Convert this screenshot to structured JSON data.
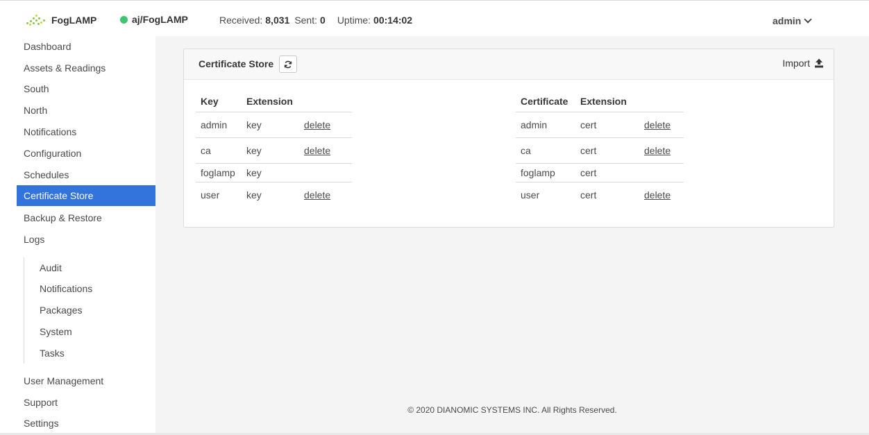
{
  "navbar": {
    "brand": "FogLAMP",
    "instance": "aj/FogLAMP",
    "received_label": "Received:",
    "received_value": "8,031",
    "sent_label": "Sent:",
    "sent_value": "0",
    "uptime_label": "Uptime:",
    "uptime_value": "00:14:02",
    "user": "admin",
    "status_color": "#3ec46d"
  },
  "sidebar": {
    "items": [
      {
        "label": "Dashboard"
      },
      {
        "label": "Assets & Readings"
      },
      {
        "label": "South"
      },
      {
        "label": "North"
      },
      {
        "label": "Notifications"
      },
      {
        "label": "Configuration"
      },
      {
        "label": "Schedules"
      },
      {
        "label": "Certificate Store",
        "active": true
      },
      {
        "label": "Backup & Restore"
      },
      {
        "label": "Logs"
      }
    ],
    "log_items": [
      {
        "label": "Audit"
      },
      {
        "label": "Notifications"
      },
      {
        "label": "Packages"
      },
      {
        "label": "System"
      },
      {
        "label": "Tasks"
      }
    ],
    "bottom_items": [
      {
        "label": "User Management"
      },
      {
        "label": "Support"
      },
      {
        "label": "Settings"
      }
    ],
    "accent_color": "#3273dc"
  },
  "card": {
    "title": "Certificate Store",
    "import_label": "Import",
    "keys_table": {
      "headers": [
        "Key",
        "Extension"
      ],
      "rows": [
        {
          "name": "admin",
          "ext": "key",
          "action": "delete"
        },
        {
          "name": "ca",
          "ext": "key",
          "action": "delete"
        },
        {
          "name": "foglamp",
          "ext": "key",
          "action": ""
        },
        {
          "name": "user",
          "ext": "key",
          "action": "delete"
        }
      ]
    },
    "certs_table": {
      "headers": [
        "Certificate",
        "Extension"
      ],
      "rows": [
        {
          "name": "admin",
          "ext": "cert",
          "action": "delete"
        },
        {
          "name": "ca",
          "ext": "cert",
          "action": "delete"
        },
        {
          "name": "foglamp",
          "ext": "cert",
          "action": ""
        },
        {
          "name": "user",
          "ext": "cert",
          "action": "delete"
        }
      ]
    }
  },
  "footer": {
    "copyright": "© 2020 DIANOMIC SYSTEMS INC. All Rights Reserved."
  }
}
